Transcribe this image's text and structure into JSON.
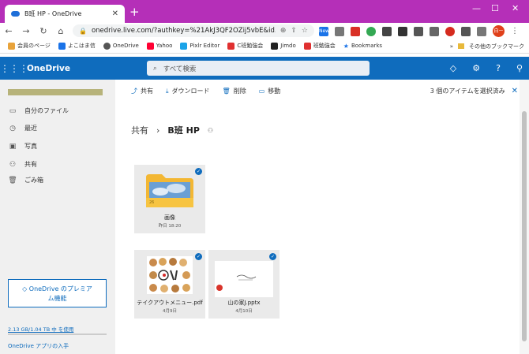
{
  "browser": {
    "tab_title": "B班 HP - OneDrive",
    "new_tab": "+",
    "url": "onedrive.live.com/?authkey=%21AkJ3QF2OZij5vbE&id...",
    "avatar_label": "白ー",
    "new_badge": "New"
  },
  "bookmarks": {
    "items": [
      {
        "label": "会員のページ",
        "color": "#e8a33b"
      },
      {
        "label": "よこはま信",
        "color": "#1a73e8"
      },
      {
        "label": "OneDrive",
        "color": "#555555"
      },
      {
        "label": "Yahoo",
        "color": "#ff0033"
      },
      {
        "label": "Pixlr Editor",
        "color": "#1aa3e8"
      },
      {
        "label": "C班勉強会",
        "color": "#e03030"
      },
      {
        "label": "Jimdo",
        "color": "#222222"
      },
      {
        "label": "班勉強会",
        "color": "#e03030"
      },
      {
        "label": "Bookmarks",
        "color": "#1a73e8"
      }
    ],
    "more": "»",
    "other": "その他のブックマーク"
  },
  "onedrive": {
    "brand": "OneDrive",
    "search_placeholder": "すべて検索"
  },
  "sidebar": {
    "items": [
      {
        "label": "自分のファイル",
        "icon": "folder-icon"
      },
      {
        "label": "最近",
        "icon": "clock-icon"
      },
      {
        "label": "写真",
        "icon": "image-icon"
      },
      {
        "label": "共有",
        "icon": "people-icon"
      },
      {
        "label": "ごみ箱",
        "icon": "trash-icon"
      }
    ],
    "premium_line1": "OneDrive のプレミア",
    "premium_line2": "ム機能",
    "storage": "2.13 GB/1.04 TB 中 を使用",
    "app_link": "OneDrive アプリの入手"
  },
  "commands": {
    "share": "共有",
    "download": "ダウンロード",
    "delete": "削除",
    "move": "移動",
    "selection": "3 個のアイテムを選択済み"
  },
  "breadcrumb": {
    "root": "共有",
    "current": "B班 HP"
  },
  "files": [
    {
      "name": "画像",
      "date": "昨日 18:20",
      "count": "26"
    },
    {
      "name": "テイクアウトメニュー.pdf",
      "date": "4月9日"
    },
    {
      "name": "山の家J.pptx",
      "date": "4月10日"
    }
  ],
  "colors": {
    "browser_title": "#b52fb8",
    "onedrive_blue": "#0f6cbd"
  }
}
